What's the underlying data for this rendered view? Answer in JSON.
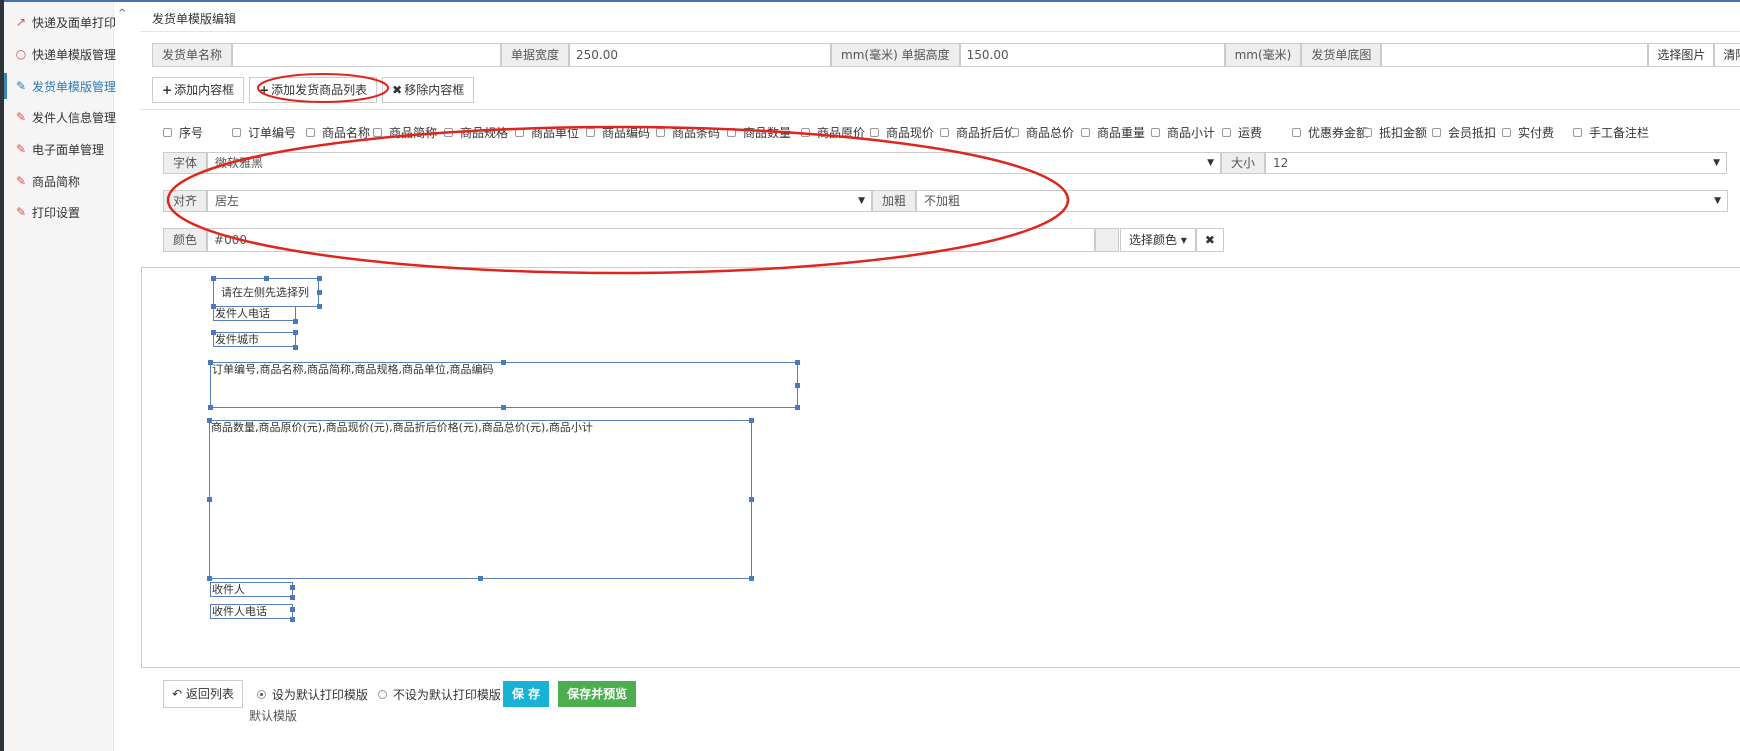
{
  "sidebar": {
    "items": [
      {
        "label": "快递及面单打印",
        "icon": "wand-icon"
      },
      {
        "label": "快递单模版管理",
        "icon": "circle-icon"
      },
      {
        "label": "发货单模版管理",
        "icon": "edit-icon",
        "active": true
      },
      {
        "label": "发件人信息管理",
        "icon": "edit-icon"
      },
      {
        "label": "电子面单管理",
        "icon": "edit-icon"
      },
      {
        "label": "商品简称",
        "icon": "edit-icon"
      },
      {
        "label": "打印设置",
        "icon": "edit-icon"
      }
    ]
  },
  "page_title": "发货单模版编辑",
  "form": {
    "name_label": "发货单名称",
    "name_value": "",
    "width_label": "单据宽度",
    "width_value": "250.00",
    "width_unit_height_label": "mm(毫米) 单据高度",
    "height_value": "150.00",
    "height_unit": "mm(毫米)",
    "bg_label": "发货单底图",
    "bg_value": "",
    "choose_image": "选择图片",
    "clear_image": "清除图片"
  },
  "toolbar": {
    "add_box": "添加内容框",
    "add_goods_list": "添加发货商品列表",
    "remove_box": "移除内容框"
  },
  "columns": [
    "序号",
    "订单编号",
    "商品名称",
    "商品简称",
    "商品规格",
    "商品单位",
    "商品编码",
    "商品条码",
    "商品数量",
    "商品原价",
    "商品现价",
    "商品折后价",
    "商品总价",
    "商品重量",
    "商品小计",
    "运费",
    "优惠券金额",
    "抵扣金额",
    "会员抵扣",
    "实付费",
    "手工备注栏"
  ],
  "style": {
    "font_label": "字体",
    "font_value": "微软雅黑",
    "size_label": "大小",
    "size_value": "12",
    "align_label": "对齐",
    "align_value": "居左",
    "bold_label": "加粗",
    "bold_value": "不加粗",
    "color_label": "颜色",
    "color_value": "#000",
    "choose_color": "选择颜色"
  },
  "canvas": {
    "boxes": [
      "请在左侧先选择列",
      "发件人电话",
      "发件城市",
      "订单编号,商品名称,商品简称,商品规格,商品单位,商品编码",
      "商品数量,商品原价(元),商品现价(元),商品折后价格(元),商品总价(元),商品小计",
      "收件人",
      "收件人电话"
    ]
  },
  "footer": {
    "back": "返回列表",
    "radio_default": "设为默认打印模版",
    "radio_not_default": "不设为默认打印模版",
    "save": "保 存",
    "save_preview": "保存并预览",
    "default_label": "默认模版"
  },
  "colors": {
    "accent": "#2e7bb6",
    "annotation": "#e0261c",
    "save": "#17b2d4",
    "save_preview": "#4cae4c"
  }
}
